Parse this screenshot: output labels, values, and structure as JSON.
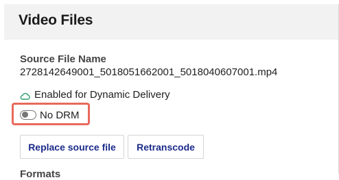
{
  "panel": {
    "title": "Video Files"
  },
  "source_file": {
    "label": "Source File Name",
    "value": "2728142649001_5018051662001_5018040607001.mp4"
  },
  "dynamic_delivery": {
    "icon": "cloud-icon",
    "text": "Enabled for Dynamic Delivery",
    "icon_color": "#2e9d6b"
  },
  "drm": {
    "toggle_on": false,
    "label": "No DRM",
    "highlight_color": "#e8695c"
  },
  "buttons": {
    "replace_label": "Replace source file",
    "retranscode_label": "Retranscode",
    "text_color": "#1a2a8a"
  },
  "next_section": {
    "label": "Formats"
  }
}
